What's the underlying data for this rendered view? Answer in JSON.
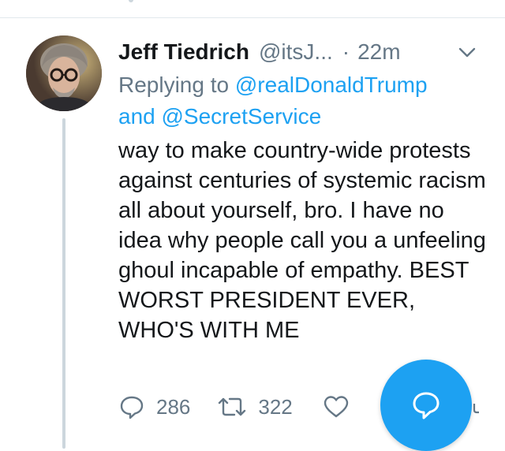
{
  "tweet": {
    "author_name": "Jeff Tiedrich",
    "handle": "@itsJ...",
    "separator": "·",
    "time": "22m",
    "replying_prefix": "Replying to",
    "mention_1": "@realDonaldTrump",
    "conjunction": "and",
    "mention_2": "@SecretService",
    "text": "way to make country-wide protests against centuries of systemic racism all about yourself, bro. I have no idea why people call you a unfeeling ghoul incapable of empathy. BEST WORST PRESIDENT EVER, WHO'S WITH ME"
  },
  "actions": {
    "reply_icon": "reply-icon",
    "reply_count": "286",
    "retweet_icon": "retweet-icon",
    "retweet_count": "322",
    "like_icon": "heart-icon"
  },
  "fab": {
    "icon": "compose-reply-icon"
  },
  "colors": {
    "accent": "#1da1f2",
    "secondary_text": "#657786",
    "primary_text": "#14171a",
    "divider": "#e1e8ed"
  }
}
